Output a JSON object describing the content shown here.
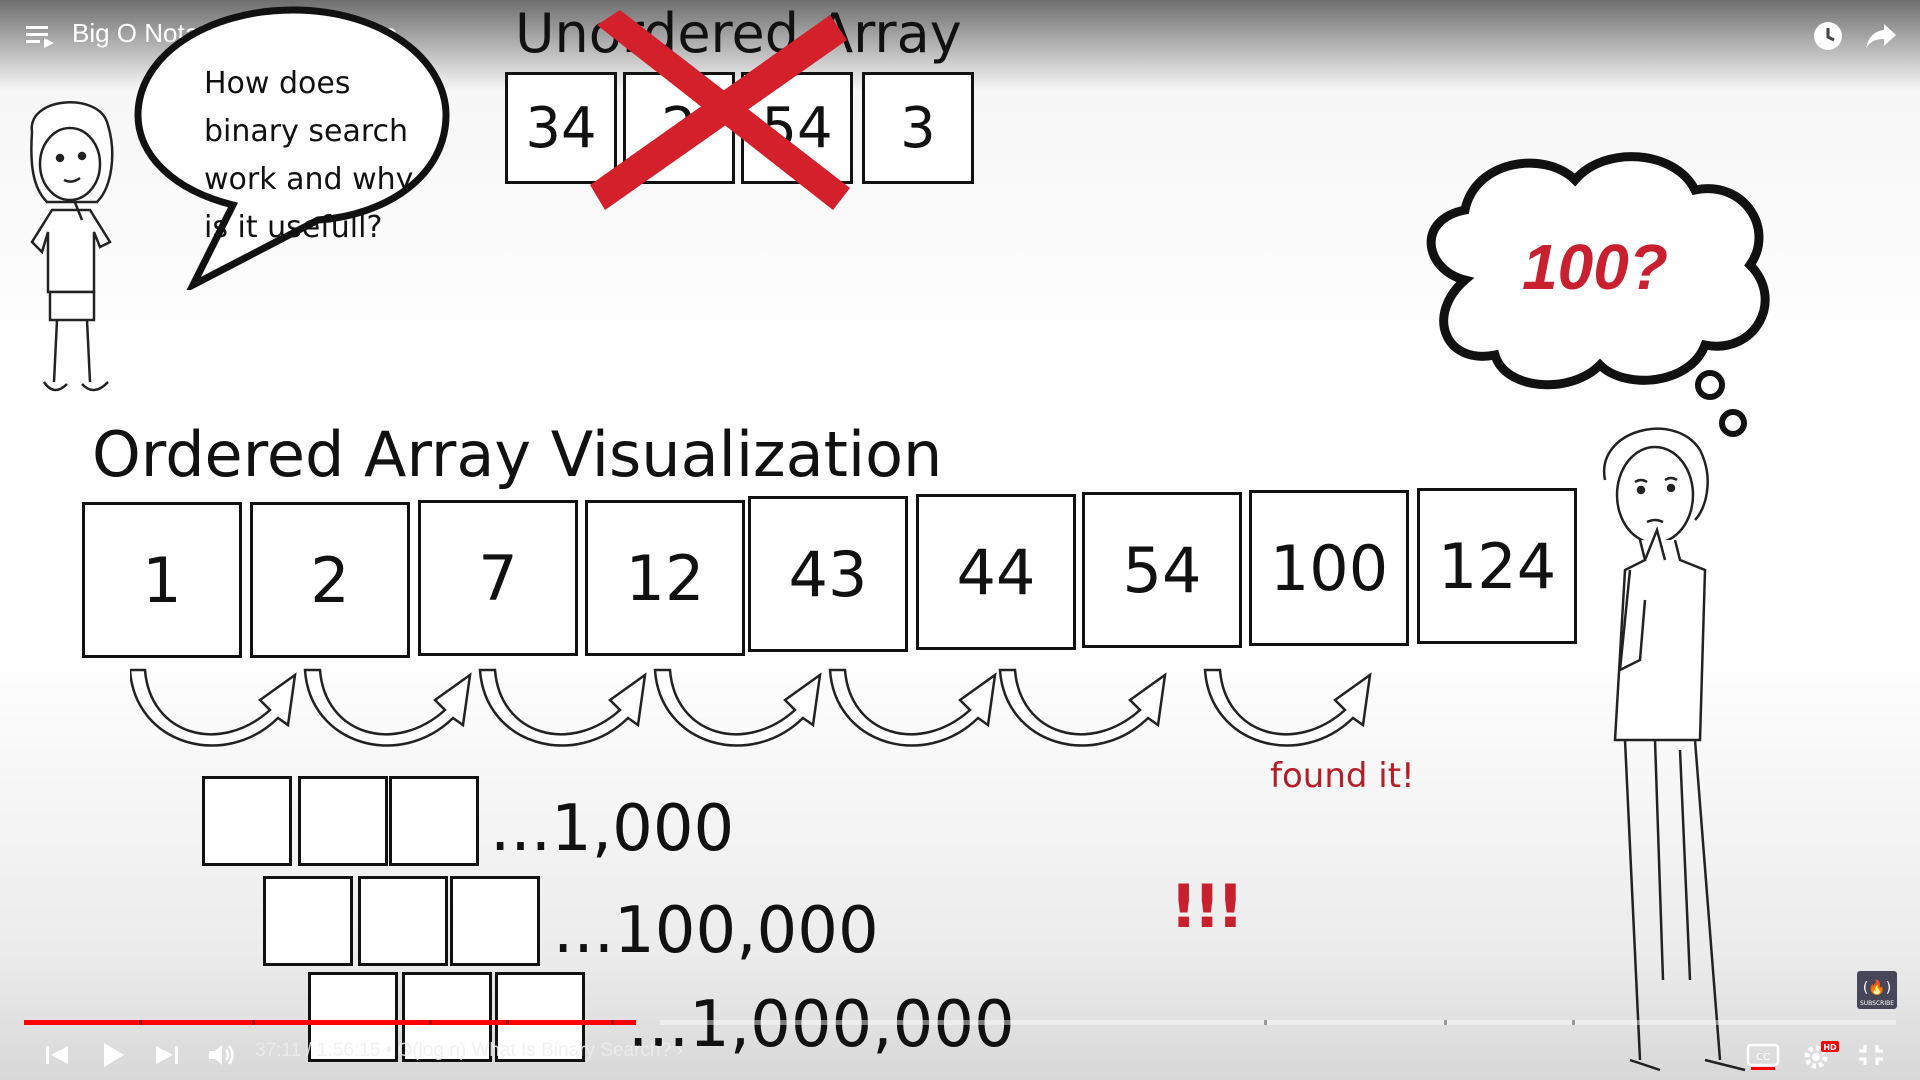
{
  "player": {
    "title": "Big O Notation - Full Course",
    "time_display": "37:11 / 1:56:15 • O(log n) What Is Binary Search? ›",
    "progress_fraction": 0.327,
    "buffer_fraction": 0.34,
    "subscribe_label": "SUBSCRIBE",
    "hd_badge": "HD",
    "icons": [
      "playlist-icon",
      "watch-later-icon",
      "share-icon",
      "previous-icon",
      "play-icon",
      "next-icon",
      "volume-icon",
      "captions-icon",
      "settings-icon",
      "exit-fullscreen-icon"
    ]
  },
  "slide": {
    "question_bubble": [
      "How does",
      "binary search",
      "work and why",
      "is it usefull?"
    ],
    "unordered": {
      "title": "Unordered Array",
      "values": [
        "34",
        "2",
        "54",
        "3"
      ]
    },
    "thought": "100?",
    "ordered": {
      "title": "Ordered Array Visualization",
      "values": [
        "1",
        "2",
        "7",
        "12",
        "43",
        "44",
        "54",
        "100",
        "124"
      ]
    },
    "found_label": "found it!",
    "scale_rows": [
      "...1,000",
      "...100,000",
      "...1,000,000"
    ],
    "exclaim": "!!!"
  },
  "colors": {
    "accent_red": "#c8202e",
    "progress_red": "#ff0000"
  }
}
